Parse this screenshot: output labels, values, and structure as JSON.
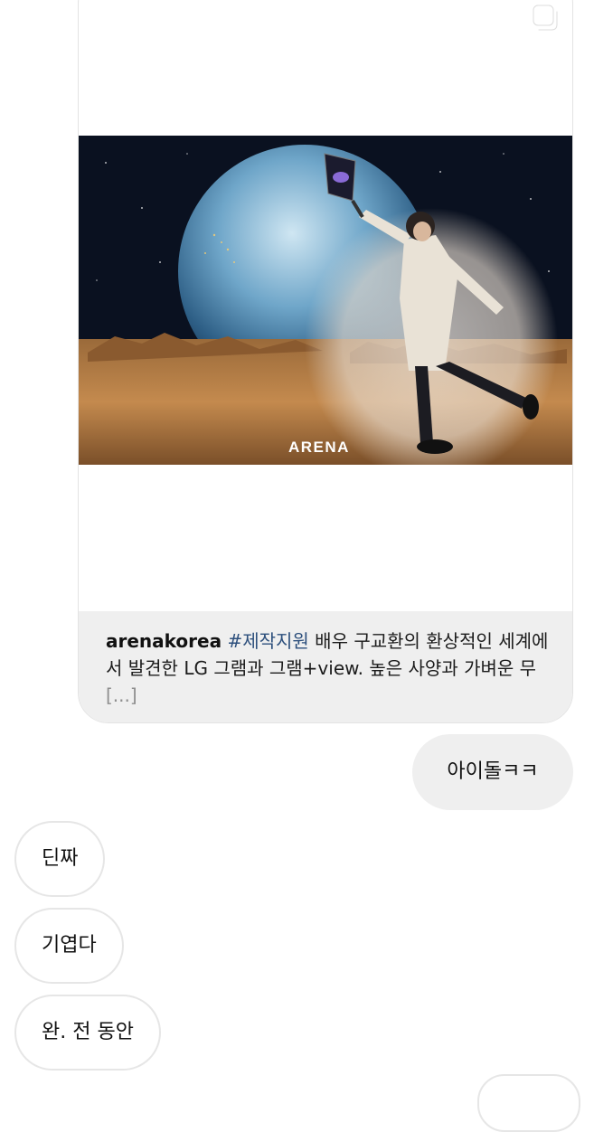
{
  "post": {
    "icon": "multiple-media-icon",
    "image_watermark": "ARENA",
    "caption": {
      "username": "arenakorea",
      "hashtag": "#제작지원",
      "text": " 배우 구교환의 환상적인 세계에서 발견한 LG 그램과 그램+view. 높은 사양과 가벼운 무 ",
      "more": "[...]"
    }
  },
  "messages": {
    "sent": [
      {
        "text": "아이돌ㅋㅋ"
      }
    ],
    "received": [
      {
        "text": "딘짜"
      },
      {
        "text": "기엽다"
      },
      {
        "text": "완. 전 동안"
      }
    ]
  },
  "colors": {
    "bubble_sent_bg": "#efefef",
    "caption_bg": "#efefef",
    "hashtag": "#2c4f7c",
    "border": "#e6e6e6"
  }
}
